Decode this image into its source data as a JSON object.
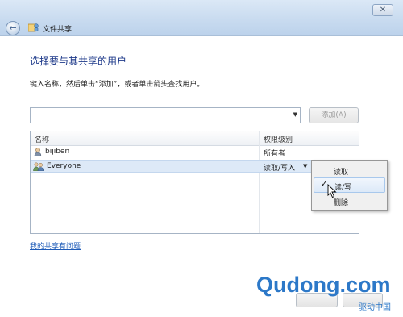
{
  "window": {
    "title": "文件共享",
    "close_glyph": "✕",
    "back_glyph": "←"
  },
  "main": {
    "heading": "选择要与其共享的用户",
    "instruction": "键入名称，然后单击“添加”，或者单击箭头查找用户。",
    "user_input": {
      "value": "",
      "placeholder": ""
    },
    "add_button": "添加(A)",
    "link": "我的共享有问题"
  },
  "table": {
    "columns": [
      "名称",
      "权限级别"
    ],
    "rows": [
      {
        "name": "bijiben",
        "permission": "所有者",
        "icon": "user-icon"
      },
      {
        "name": "Everyone",
        "permission": "读取/写入",
        "icon": "group-icon"
      }
    ]
  },
  "menu": {
    "items": [
      {
        "label": "读取",
        "checked": false
      },
      {
        "label": "读/写",
        "checked": true
      },
      {
        "label": "删除",
        "checked": false
      }
    ],
    "check_glyph": "✓"
  },
  "watermark": {
    "brand": "Qudong.com",
    "sub": "驱动中国"
  },
  "colors": {
    "heading": "#1e3a8a",
    "link": "#1e5bb8",
    "watermark": "#2c78c8",
    "selection": "#dde9f7"
  }
}
